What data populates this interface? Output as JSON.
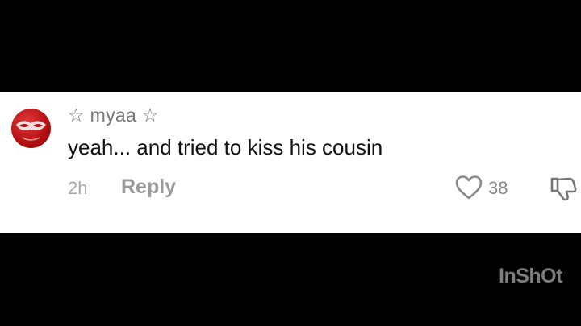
{
  "comment": {
    "username": "☆ myaa ☆",
    "text": "yeah... and tried to kiss his cousin",
    "time": "2h",
    "reply_label": "Reply",
    "like_count": "38",
    "like_icon": "heart-outline-icon",
    "dislike_icon": "thumbs-down-icon",
    "avatar": "red-avatar"
  },
  "watermark": {
    "text": "InShOt"
  },
  "colors": {
    "background": "#000000",
    "card": "#ffffff",
    "avatar_red": "#c41416",
    "text_primary": "#111111",
    "text_secondary": "#9a9a9a"
  }
}
